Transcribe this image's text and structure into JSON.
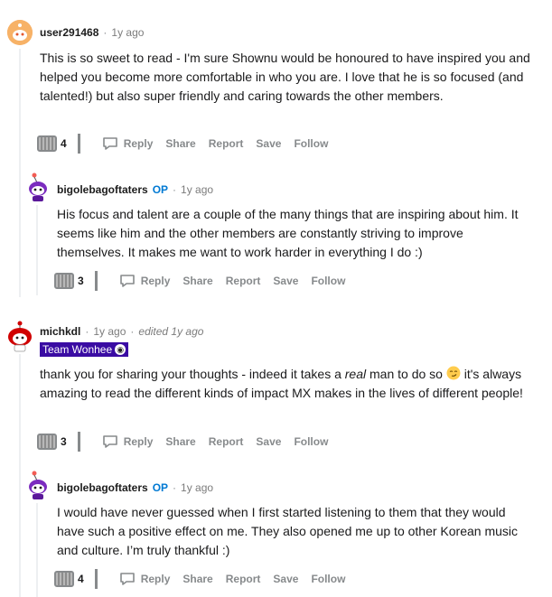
{
  "comments": [
    {
      "username": "user291468",
      "time": "1y ago",
      "body": "This is so sweet to read - I'm sure Shownu would be honoured to have inspired you and helped you become more comfortable in who you are. I love that he is so focused (and talented!) but also super friendly and caring towards the other members.",
      "votes": "4",
      "actions": {
        "reply": "Reply",
        "share": "Share",
        "report": "Report",
        "save": "Save",
        "follow": "Follow"
      }
    },
    {
      "username": "bigolebagoftaters",
      "op": "OP",
      "time": "1y ago",
      "body": "His focus and talent are a couple of the many things that are inspiring about him. It seems like him and the other members are constantly striving to improve themselves. It makes me want to work harder in everything I do :)",
      "votes": "3",
      "actions": {
        "reply": "Reply",
        "share": "Share",
        "report": "Report",
        "save": "Save",
        "follow": "Follow"
      }
    },
    {
      "username": "michkdl",
      "time": "1y ago",
      "edited": "edited 1y ago",
      "flair": "Team Wonhee",
      "body_before": "thank you for sharing your thoughts - indeed it takes a ",
      "body_em": "real",
      "body_mid": " man to do so ",
      "body_after": " it's always amazing to read the different kinds of impact MX makes in the lives of different people!",
      "votes": "3",
      "actions": {
        "reply": "Reply",
        "share": "Share",
        "report": "Report",
        "save": "Save",
        "follow": "Follow"
      }
    },
    {
      "username": "bigolebagoftaters",
      "op": "OP",
      "time": "1y ago",
      "body": "I would have never guessed when I first started listening to them that they would have such a positive effect on me. They also opened me up to other Korean music and culture. I’m truly thankful :)",
      "votes": "4",
      "actions": {
        "reply": "Reply",
        "share": "Share",
        "report": "Report",
        "save": "Save",
        "follow": "Follow"
      }
    }
  ],
  "separator": "·",
  "colors": {
    "op": "#0079d3",
    "flair_bg": "#3a0ca3",
    "muted": "#878a8c"
  }
}
